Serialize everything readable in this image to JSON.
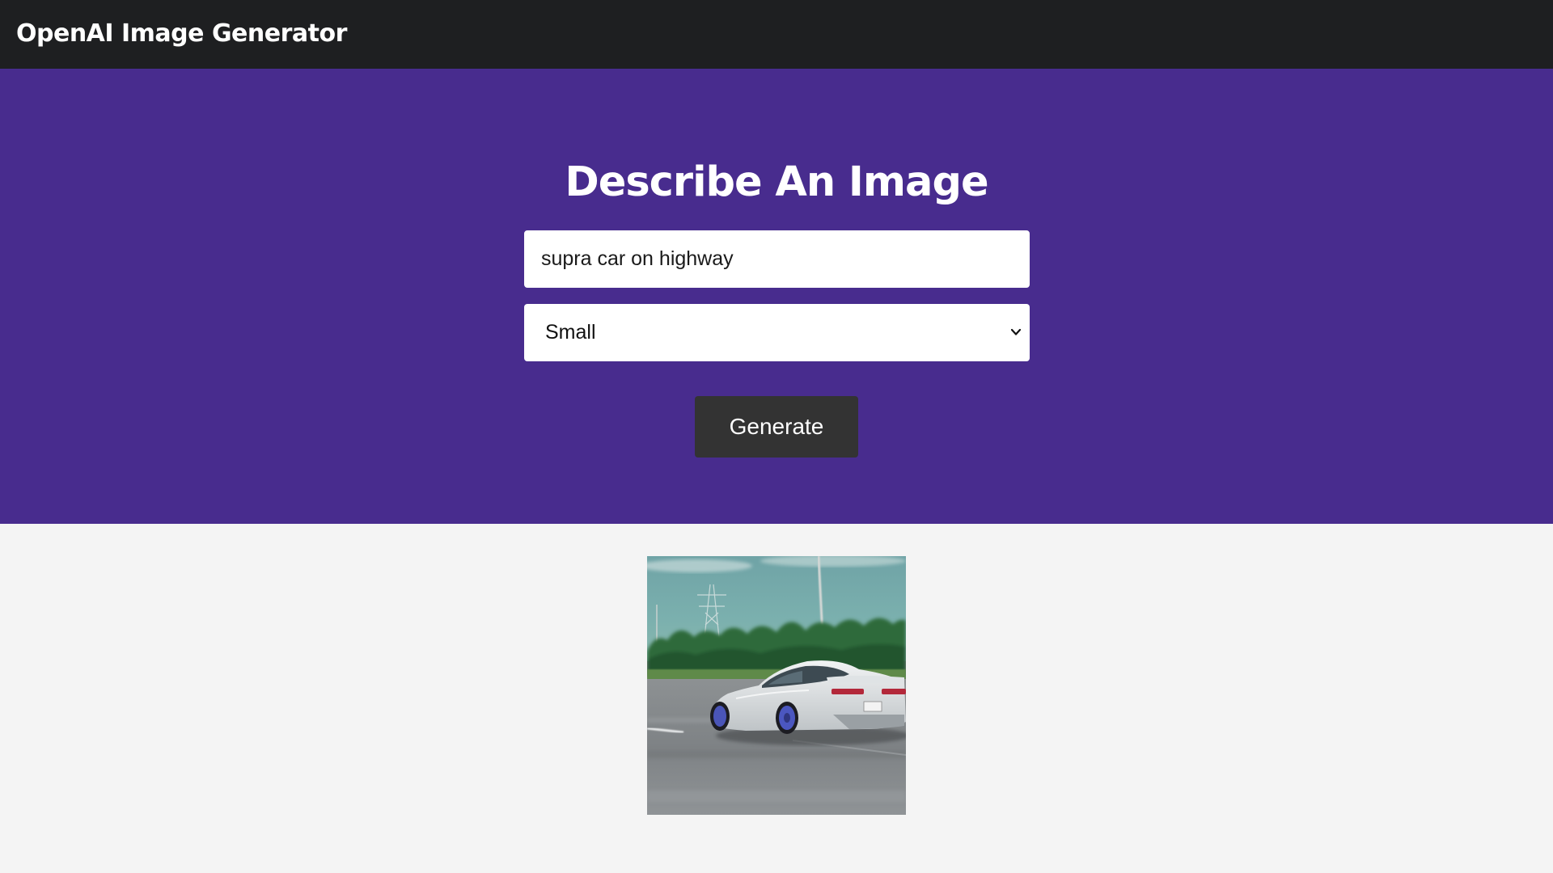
{
  "navbar": {
    "title": "OpenAI Image Generator"
  },
  "showcase": {
    "heading": "Describe An Image",
    "prompt": {
      "value": "supra car on highway",
      "aria_label": "Image description"
    },
    "size_select": {
      "selected": "Small"
    },
    "generate_label": "Generate"
  },
  "result": {
    "image_alt": "supra car on highway"
  },
  "colors": {
    "navbar_bg": "#1e1f21",
    "showcase_bg": "#482c8e",
    "page_bg": "#f4f4f4",
    "button_bg": "#333333"
  },
  "icons": {
    "select_chevron": "chevron-down-icon"
  }
}
